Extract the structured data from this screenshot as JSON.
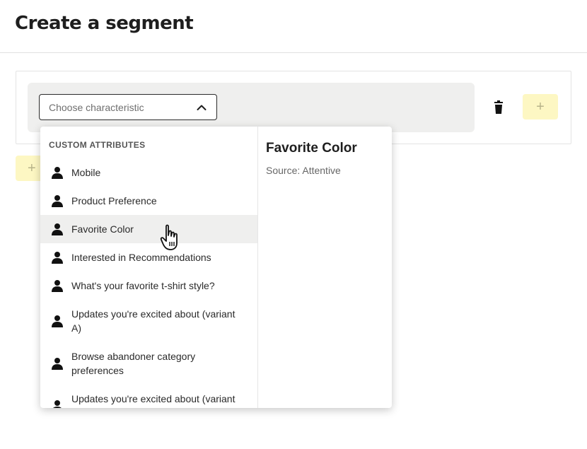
{
  "page": {
    "title": "Create a segment"
  },
  "condition": {
    "select_placeholder": "Choose characteristic",
    "add_condition_label": "+",
    "add_group_label": "+"
  },
  "dropdown": {
    "group_heading": "CUSTOM ATTRIBUTES",
    "options": [
      "Mobile",
      "Product Preference",
      "Favorite Color",
      "Interested in Recommendations",
      "What's your favorite t-shirt style?",
      "Updates you're excited about (variant A)",
      "Browse abandoner category preferences",
      "Updates you're excited about (variant B)"
    ],
    "highlighted_option": "Favorite Color",
    "option_icon": "person-icon"
  },
  "detail": {
    "title": "Favorite Color",
    "source": "Source: Attentive"
  },
  "colors": {
    "accent_yellow": "#fdf7c3",
    "row_background": "#efefee",
    "border_dark": "#2b2b2b"
  }
}
